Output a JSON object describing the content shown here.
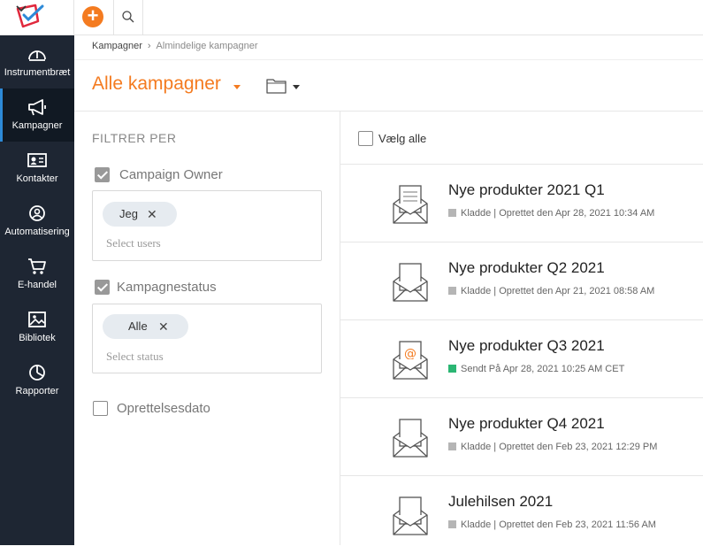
{
  "header": {
    "add_label": "+"
  },
  "sidebar": {
    "items": [
      {
        "label": "Instrumentbræt",
        "icon": "gauge-icon"
      },
      {
        "label": "Kampagner",
        "icon": "megaphone-icon"
      },
      {
        "label": "Kontakter",
        "icon": "contact-card-icon"
      },
      {
        "label": "Automatisering",
        "icon": "automation-icon"
      },
      {
        "label": "E-handel",
        "icon": "cart-icon"
      },
      {
        "label": "Bibliotek",
        "icon": "gallery-icon"
      },
      {
        "label": "Rapporter",
        "icon": "pie-chart-icon"
      }
    ]
  },
  "breadcrumb": {
    "root": "Kampagner",
    "separator": "›",
    "current": "Almindelige kampagner"
  },
  "page": {
    "title": "Alle kampagner"
  },
  "filters": {
    "heading": "FILTRER PER",
    "owner": {
      "label": "Campaign Owner",
      "checked": true,
      "chip": "Jeg",
      "placeholder": "Select users"
    },
    "status": {
      "label": "Kampagnestatus",
      "checked": true,
      "chip": "Alle",
      "placeholder": "Select status"
    },
    "created": {
      "label": "Oprettelsesdato",
      "checked": false
    }
  },
  "list": {
    "select_all": "Vælg alle",
    "campaigns": [
      {
        "name": "Nye produkter 2021 Q1",
        "meta": "Kladde | Oprettet den Apr 28, 2021 10:34 AM",
        "status_color": "#b5b5b5",
        "icon": "envelope-letter-icon"
      },
      {
        "name": "Nye produkter Q2 2021",
        "meta": "Kladde | Oprettet den Apr 21, 2021 08:58 AM",
        "status_color": "#b5b5b5",
        "icon": "envelope-icon"
      },
      {
        "name": "Nye produkter Q3 2021",
        "meta": "Sendt På Apr 28, 2021 10:25 AM CET",
        "status_color": "#2bb673",
        "icon": "envelope-at-icon"
      },
      {
        "name": "Nye produkter Q4 2021",
        "meta": "Kladde | Oprettet den Feb 23, 2021 12:29 PM",
        "status_color": "#b5b5b5",
        "icon": "envelope-icon"
      },
      {
        "name": "Julehilsen 2021",
        "meta": "Kladde | Oprettet den Feb 23, 2021 11:56 AM",
        "status_color": "#b5b5b5",
        "icon": "envelope-icon"
      }
    ]
  },
  "colors": {
    "accent": "#f47b20",
    "sidebar": "#1e2633",
    "active_indicator": "#2d8ad8",
    "sent": "#2bb673",
    "draft": "#b5b5b5"
  }
}
